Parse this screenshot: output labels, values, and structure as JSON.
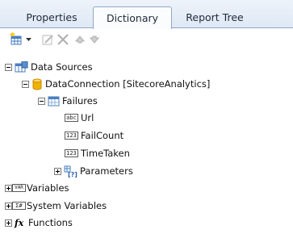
{
  "tabs": [
    {
      "label": "Properties",
      "active": false
    },
    {
      "label": "Dictionary",
      "active": true
    },
    {
      "label": "Report Tree",
      "active": false
    }
  ],
  "toolbar": {
    "new_icon": "new-item-icon",
    "dropdown_icon": "dropdown-arrow-icon",
    "edit_icon": "edit-icon",
    "delete_icon": "delete-icon",
    "move_up_icon": "move-up-icon",
    "move_down_icon": "move-down-icon"
  },
  "tree": {
    "data_sources": "Data Sources",
    "connection": "DataConnection [SitecoreAnalytics]",
    "table": "Failures",
    "fields": [
      {
        "badge": "abc",
        "label": "Url"
      },
      {
        "badge": "123",
        "label": "FailCount"
      },
      {
        "badge": "123",
        "label": "TimeTaken"
      }
    ],
    "parameters": "Parameters",
    "variables_badge": "VAR",
    "variables": "Variables",
    "system_variables_badge": "Σ#",
    "system_variables": "System Variables",
    "functions_badge": "fx",
    "functions": "Functions"
  },
  "colors": {
    "tab_border": "#8ea8c9",
    "database_gold": "#e8a200",
    "table_blue": "#4a7fc1"
  }
}
